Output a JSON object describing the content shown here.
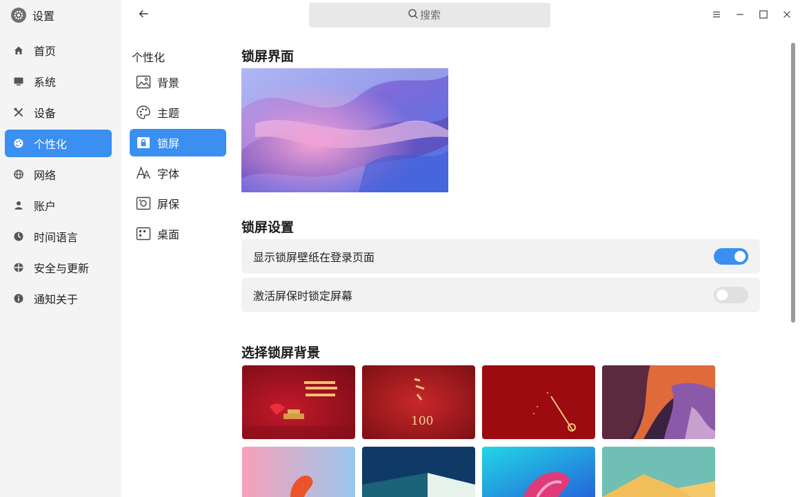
{
  "app": {
    "title": "设置",
    "icon": "gear-icon"
  },
  "sidebar": {
    "items": [
      {
        "label": "首页",
        "icon": "home-icon"
      },
      {
        "label": "系统",
        "icon": "monitor-icon"
      },
      {
        "label": "设备",
        "icon": "tools-icon"
      },
      {
        "label": "个性化",
        "icon": "palette-icon",
        "active": true
      },
      {
        "label": "网络",
        "icon": "globe-icon"
      },
      {
        "label": "账户",
        "icon": "user-icon"
      },
      {
        "label": "时间语言",
        "icon": "clock-icon"
      },
      {
        "label": "安全与更新",
        "icon": "shield-icon"
      },
      {
        "label": "通知关于",
        "icon": "info-icon"
      }
    ]
  },
  "topbar": {
    "back_icon": "back-arrow-icon",
    "search_placeholder": "搜索",
    "search_icon": "search-icon"
  },
  "window_controls": [
    "menu-icon",
    "minimize-icon",
    "maximize-icon",
    "close-icon"
  ],
  "subnav": {
    "title": "个性化",
    "items": [
      {
        "label": "背景",
        "icon": "image-icon"
      },
      {
        "label": "主题",
        "icon": "palette-icon"
      },
      {
        "label": "锁屏",
        "icon": "lockscreen-icon",
        "active": true
      },
      {
        "label": "字体",
        "icon": "font-icon"
      },
      {
        "label": "屏保",
        "icon": "screensaver-icon"
      },
      {
        "label": "桌面",
        "icon": "desktop-icon"
      }
    ]
  },
  "main": {
    "preview_title": "锁屏界面",
    "settings_title": "锁屏设置",
    "settings": [
      {
        "label": "显示锁屏壁纸在登录页面",
        "enabled": true
      },
      {
        "label": "激活屏保时锁定屏幕",
        "enabled": false
      }
    ],
    "backgrounds_title": "选择锁屏背景"
  },
  "colors": {
    "accent": "#3a8ff1",
    "sidebar_bg": "#f4f4f4",
    "row_bg": "#f2f2f2"
  }
}
